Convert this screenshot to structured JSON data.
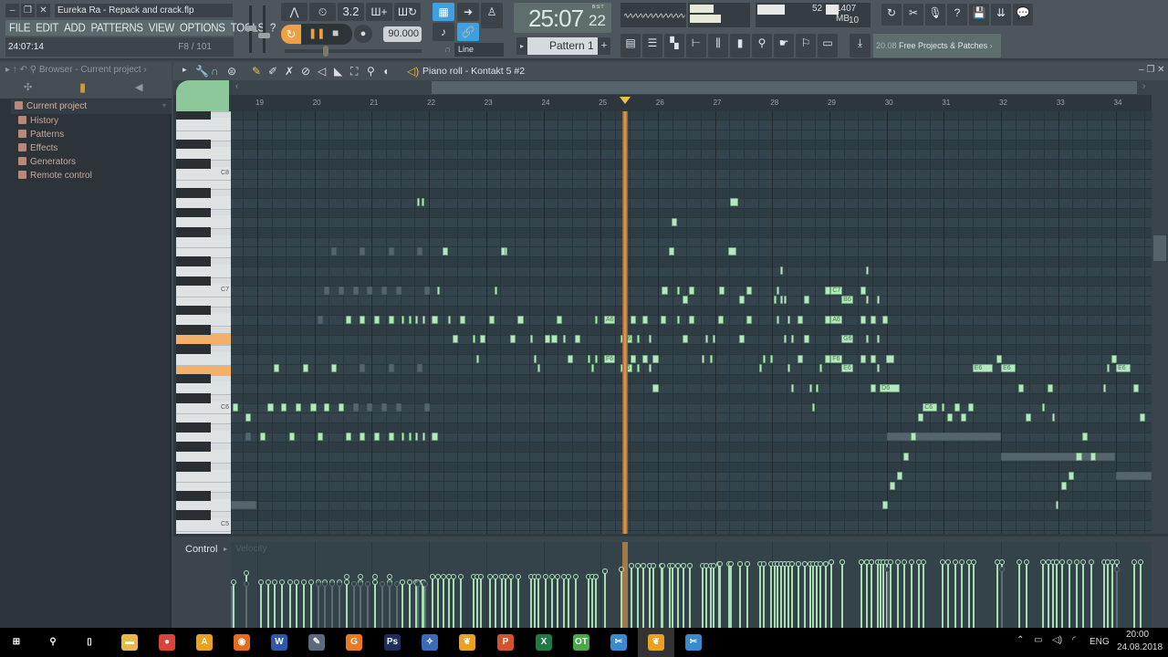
{
  "window": {
    "title": "Eureka Ra - Repack and crack.flp",
    "controls": [
      "minimize",
      "restore",
      "close"
    ]
  },
  "menu": [
    "FILE",
    "EDIT",
    "ADD",
    "PATTERNS",
    "VIEW",
    "OPTIONS",
    "TOOLS",
    "?"
  ],
  "hint": {
    "time": "24:07:14",
    "info": "F8 / 101"
  },
  "transport": {
    "tempo": "90.000",
    "snap_mode": "Line",
    "time_big": "25:07",
    "time_small": "22",
    "time_format": "B:S:T",
    "pattern": "Pattern 1",
    "pattern_add": "+",
    "step_label": "3.2"
  },
  "monitor": {
    "cpu": "52",
    "memory": "1407 MB",
    "polyphony": "10"
  },
  "news": {
    "date": "20.08",
    "text": "Free Projects & Patches"
  },
  "browser": {
    "header": "Browser - Current project",
    "root": "Current project",
    "items": [
      "History",
      "Patterns",
      "Effects",
      "Generators",
      "Remote control"
    ]
  },
  "piano_roll": {
    "title": "Piano roll - Kontakt 5 #2",
    "bars": [
      19,
      20,
      21,
      22,
      23,
      24,
      25,
      26,
      27,
      28,
      29,
      30,
      31,
      32,
      33,
      34
    ],
    "octave_labels": [
      "C8",
      "C7",
      "C6",
      "C5"
    ],
    "playhead_bar": 25.43,
    "highlighted_keys": [
      "G6",
      "E6"
    ],
    "accent": "#b5e8be",
    "playhead_color": "#e8a050"
  },
  "control": {
    "label": "Control",
    "param": "Velocity"
  },
  "notes": [
    [
      18.54,
      62,
      0.45,
      1,
      0.6
    ],
    [
      18.57,
      72,
      0.1,
      0,
      0.62
    ],
    [
      18.79,
      71,
      0.1,
      0,
      0.75
    ],
    [
      18.79,
      69,
      0.1,
      1,
      0.6
    ],
    [
      19.05,
      69,
      0.1,
      0,
      0.62
    ],
    [
      19.18,
      72,
      0.1,
      0,
      0.62
    ],
    [
      19.29,
      76,
      0.1,
      0,
      0.62
    ],
    [
      19.41,
      72,
      0.1,
      0,
      0.62
    ],
    [
      19.56,
      69,
      0.1,
      0,
      0.62
    ],
    [
      19.67,
      72,
      0.1,
      0,
      0.62
    ],
    [
      19.8,
      76,
      0.1,
      0,
      0.62
    ],
    [
      19.93,
      72,
      0.1,
      0,
      0.62
    ],
    [
      20.05,
      69,
      0.1,
      0,
      0.62
    ],
    [
      20.05,
      81,
      0.1,
      1,
      0.6
    ],
    [
      20.16,
      72,
      0.1,
      0,
      0.62
    ],
    [
      20.16,
      84,
      0.1,
      1,
      0.6
    ],
    [
      20.29,
      76,
      0.1,
      0,
      0.62
    ],
    [
      20.29,
      88,
      0.1,
      1,
      0.6
    ],
    [
      20.42,
      72,
      0.1,
      0,
      0.62
    ],
    [
      20.42,
      84,
      0.1,
      1,
      0.6
    ],
    [
      20.55,
      81,
      0.1,
      0,
      0.7
    ],
    [
      20.55,
      69,
      0.1,
      0,
      0.62
    ],
    [
      20.67,
      72,
      0.1,
      1,
      0.6
    ],
    [
      20.67,
      84,
      0.1,
      1,
      0.6
    ],
    [
      20.79,
      81,
      0.1,
      0,
      0.7
    ],
    [
      20.79,
      69,
      0.1,
      0,
      0.62
    ],
    [
      20.79,
      88,
      0.1,
      1,
      0.6
    ],
    [
      20.79,
      76,
      0.1,
      1,
      0.6
    ],
    [
      20.91,
      84,
      0.1,
      1,
      0.6
    ],
    [
      20.91,
      72,
      0.1,
      1,
      0.6
    ],
    [
      21.04,
      81,
      0.1,
      0,
      0.7
    ],
    [
      21.04,
      69,
      0.1,
      0,
      0.62
    ],
    [
      21.17,
      84,
      0.1,
      1,
      0.6
    ],
    [
      21.17,
      72,
      0.1,
      1,
      0.6
    ],
    [
      21.3,
      81,
      0.1,
      0,
      0.7
    ],
    [
      21.3,
      69,
      0.1,
      0,
      0.62
    ],
    [
      21.3,
      88,
      0.1,
      1,
      0.6
    ],
    [
      21.3,
      76,
      0.1,
      1,
      0.6
    ],
    [
      21.42,
      84,
      0.1,
      1,
      0.6
    ],
    [
      21.42,
      72,
      0.1,
      1,
      0.6
    ],
    [
      21.52,
      81,
      0.05,
      0,
      0.62
    ],
    [
      21.52,
      69,
      0.05,
      0,
      0.62
    ],
    [
      21.65,
      81,
      0.05,
      0,
      0.62
    ],
    [
      21.65,
      69,
      0.05,
      0,
      0.62
    ],
    [
      21.76,
      81,
      0.05,
      0,
      0.62
    ],
    [
      21.76,
      69,
      0.05,
      0,
      0.62
    ],
    [
      21.79,
      93,
      0.05,
      0,
      0.62
    ],
    [
      21.87,
      93,
      0.05,
      0,
      0.62
    ],
    [
      21.89,
      81,
      0.05,
      0,
      0.62
    ],
    [
      21.89,
      69,
      0.05,
      0,
      0.62
    ],
    [
      21.79,
      88,
      0.1,
      1,
      0.6
    ],
    [
      21.79,
      76,
      0.1,
      1,
      0.6
    ],
    [
      21.92,
      84,
      0.1,
      1,
      0.6
    ],
    [
      21.92,
      72,
      0.1,
      1,
      0.6
    ],
    [
      22.05,
      81,
      0.1,
      0,
      0.7
    ],
    [
      22.05,
      69,
      0.1,
      0,
      0.7
    ],
    [
      22.14,
      84,
      0.05,
      0,
      0.7
    ],
    [
      22.24,
      88,
      0.1,
      0,
      0.7
    ],
    [
      22.33,
      81,
      0.05,
      0,
      0.7
    ],
    [
      22.41,
      79,
      0.1,
      0,
      0.7
    ],
    [
      22.54,
      81,
      0.1,
      0,
      0.7
    ],
    [
      22.76,
      79,
      0.05,
      0,
      0.7
    ],
    [
      22.83,
      77,
      0.05,
      0,
      0.7
    ],
    [
      22.89,
      79,
      0.1,
      0,
      0.7
    ],
    [
      23.05,
      81,
      0.1,
      0,
      0.7
    ],
    [
      23.15,
      84,
      0.05,
      0,
      0.7
    ],
    [
      23.26,
      88,
      0.08,
      0,
      0.7
    ],
    [
      23.32,
      88,
      0.05,
      0,
      0.7
    ],
    [
      23.42,
      79,
      0.1,
      0,
      0.7
    ],
    [
      23.55,
      81,
      0.1,
      0,
      0.7
    ],
    [
      23.77,
      79,
      0.05,
      0,
      0.7
    ],
    [
      23.83,
      77,
      0.05,
      0,
      0.7
    ],
    [
      23.9,
      76,
      0.05,
      0,
      0.7
    ],
    [
      24.02,
      79,
      0.1,
      0,
      0.7
    ],
    [
      24.14,
      79,
      0.1,
      0,
      0.7
    ],
    [
      24.23,
      81,
      0.1,
      0,
      0.7
    ],
    [
      24.34,
      79,
      0.05,
      0,
      0.7
    ],
    [
      24.42,
      77,
      0.1,
      0,
      0.7
    ],
    [
      24.55,
      79,
      0.1,
      0,
      0.7
    ],
    [
      24.77,
      77,
      0.05,
      0,
      0.7
    ],
    [
      24.84,
      76,
      0.05,
      0,
      0.7
    ],
    [
      24.9,
      81,
      0.05,
      0,
      0.7
    ],
    [
      24.9,
      77,
      0.05,
      0,
      0.7
    ],
    [
      25.06,
      81,
      0.2,
      0,
      0.78
    ],
    [
      25.06,
      77,
      0.2,
      0,
      0.78
    ],
    [
      25.35,
      79,
      0.2,
      0,
      0.8
    ],
    [
      25.35,
      76,
      0.2,
      0,
      0.8
    ],
    [
      25.52,
      81,
      0.1,
      0,
      0.85
    ],
    [
      25.52,
      77,
      0.1,
      0,
      0.85
    ],
    [
      25.63,
      79,
      0.05,
      0,
      0.85
    ],
    [
      25.63,
      76,
      0.05,
      0,
      0.85
    ],
    [
      25.73,
      81,
      0.1,
      0,
      0.85
    ],
    [
      25.73,
      77,
      0.1,
      0,
      0.85
    ],
    [
      25.84,
      79,
      0.05,
      0,
      0.85
    ],
    [
      25.84,
      76,
      0.05,
      0,
      0.85
    ],
    [
      25.91,
      77,
      0.1,
      0,
      0.85
    ],
    [
      25.91,
      74,
      0.1,
      0,
      0.85
    ],
    [
      26.05,
      81,
      0.1,
      0,
      0.85
    ],
    [
      26.07,
      84,
      0.1,
      0,
      0.85
    ],
    [
      26.19,
      88,
      0.1,
      0,
      0.85
    ],
    [
      26.24,
      91,
      0.1,
      0,
      0.85
    ],
    [
      26.34,
      84,
      0.05,
      0,
      0.85
    ],
    [
      26.34,
      81,
      0.05,
      0,
      0.85
    ],
    [
      26.43,
      83,
      0.1,
      0,
      0.85
    ],
    [
      26.43,
      79,
      0.1,
      0,
      0.85
    ],
    [
      26.54,
      84,
      0.1,
      0,
      0.85
    ],
    [
      26.54,
      81,
      0.1,
      0,
      0.85
    ],
    [
      26.77,
      77,
      0.05,
      0,
      0.85
    ],
    [
      26.83,
      79,
      0.05,
      0,
      0.85
    ],
    [
      26.91,
      77,
      0.05,
      0,
      0.85
    ],
    [
      26.96,
      79,
      0.05,
      0,
      0.85
    ],
    [
      27.05,
      81,
      0.1,
      0,
      0.88
    ],
    [
      27.07,
      84,
      0.1,
      0,
      0.88
    ],
    [
      27.23,
      88,
      0.15,
      0,
      0.88
    ],
    [
      27.26,
      93,
      0.15,
      0,
      0.88
    ],
    [
      27.42,
      83,
      0.1,
      0,
      0.88
    ],
    [
      27.42,
      79,
      0.1,
      0,
      0.88
    ],
    [
      27.55,
      84,
      0.1,
      0,
      0.88
    ],
    [
      27.55,
      81,
      0.1,
      0,
      0.88
    ],
    [
      27.77,
      76,
      0.05,
      0,
      0.88
    ],
    [
      27.84,
      77,
      0.05,
      0,
      0.88
    ],
    [
      27.96,
      77,
      0.05,
      0,
      0.88
    ],
    [
      28.03,
      83,
      0.05,
      0,
      0.88
    ],
    [
      28.08,
      84,
      0.05,
      0,
      0.88
    ],
    [
      28.08,
      81,
      0.05,
      0,
      0.88
    ],
    [
      28.14,
      86,
      0.05,
      0,
      0.88
    ],
    [
      28.14,
      83,
      0.05,
      0,
      0.88
    ],
    [
      28.2,
      83,
      0.05,
      0,
      0.88
    ],
    [
      28.2,
      79,
      0.05,
      0,
      0.88
    ],
    [
      28.27,
      81,
      0.05,
      0,
      0.88
    ],
    [
      28.27,
      76,
      0.05,
      0,
      0.88
    ],
    [
      28.33,
      79,
      0.05,
      0,
      0.88
    ],
    [
      28.33,
      74,
      0.05,
      0,
      0.88
    ],
    [
      28.44,
      81,
      0.1,
      0,
      0.88
    ],
    [
      28.44,
      77,
      0.1,
      0,
      0.88
    ],
    [
      28.55,
      83,
      0.1,
      0,
      0.88
    ],
    [
      28.55,
      79,
      0.1,
      0,
      0.88
    ],
    [
      28.65,
      74,
      0.05,
      0,
      0.88
    ],
    [
      28.7,
      72,
      0.05,
      0,
      0.88
    ],
    [
      28.76,
      74,
      0.05,
      0,
      0.88
    ],
    [
      28.82,
      76,
      0.05,
      0,
      0.88
    ],
    [
      28.92,
      84,
      0.1,
      0,
      0.88
    ],
    [
      28.92,
      81,
      0.1,
      0,
      0.88
    ],
    [
      28.92,
      77,
      0.1,
      0,
      0.88
    ],
    [
      29.02,
      84,
      0.2,
      0,
      0.9
    ],
    [
      29.02,
      81,
      0.2,
      0,
      0.9
    ],
    [
      29.02,
      77,
      0.2,
      0,
      0.9
    ],
    [
      29.21,
      83,
      0.2,
      0,
      0.9
    ],
    [
      29.21,
      79,
      0.2,
      0,
      0.9
    ],
    [
      29.21,
      76,
      0.2,
      0,
      0.9
    ],
    [
      29.54,
      84,
      0.1,
      0,
      0.9
    ],
    [
      29.54,
      81,
      0.1,
      0,
      0.9
    ],
    [
      29.54,
      77,
      0.1,
      0,
      0.9
    ],
    [
      29.64,
      86,
      0.05,
      0,
      0.9
    ],
    [
      29.64,
      83,
      0.05,
      0,
      0.9
    ],
    [
      29.64,
      79,
      0.05,
      0,
      0.9
    ],
    [
      29.72,
      81,
      0.1,
      0,
      0.9
    ],
    [
      29.72,
      77,
      0.1,
      0,
      0.9
    ],
    [
      29.72,
      74,
      0.1,
      0,
      0.9
    ],
    [
      29.83,
      83,
      0.05,
      0,
      0.9
    ],
    [
      29.83,
      79,
      0.05,
      0,
      0.9
    ],
    [
      29.83,
      76,
      0.05,
      0,
      0.9
    ],
    [
      29.88,
      74,
      0.35,
      0,
      0.9
    ],
    [
      29.92,
      81,
      0.1,
      0,
      0.9
    ],
    [
      29.92,
      62,
      0.1,
      0,
      0.9
    ],
    [
      29.99,
      77,
      0.15,
      0,
      0.9
    ],
    [
      30.0,
      69,
      2.0,
      1,
      0.8
    ],
    [
      30.05,
      64,
      0.1,
      0,
      0.9
    ],
    [
      30.18,
      65,
      0.1,
      0,
      0.9
    ],
    [
      30.29,
      67,
      0.1,
      0,
      0.9
    ],
    [
      30.42,
      69,
      0.1,
      0,
      0.9
    ],
    [
      30.55,
      71,
      0.1,
      0,
      0.9
    ],
    [
      30.63,
      72,
      0.25,
      0,
      0.9
    ],
    [
      30.96,
      72,
      0.05,
      0,
      0.9
    ],
    [
      31.06,
      71,
      0.1,
      0,
      0.9
    ],
    [
      31.18,
      72,
      0.1,
      0,
      0.9
    ],
    [
      31.3,
      71,
      0.1,
      0,
      0.9
    ],
    [
      31.42,
      72,
      0.1,
      0,
      0.9
    ],
    [
      31.5,
      76,
      0.36,
      0,
      0.9
    ],
    [
      31.92,
      77,
      0.1,
      0,
      0.9
    ],
    [
      32.0,
      76,
      0.25,
      0,
      0.9
    ],
    [
      32.0,
      67,
      2.0,
      1,
      0.8
    ],
    [
      32.3,
      74,
      0.1,
      0,
      0.9
    ],
    [
      32.43,
      71,
      0.1,
      0,
      0.9
    ],
    [
      32.72,
      72,
      0.05,
      0,
      0.9
    ],
    [
      32.81,
      74,
      0.1,
      0,
      0.9
    ],
    [
      32.89,
      71,
      0.05,
      0,
      0.9
    ],
    [
      32.96,
      62,
      0.05,
      0,
      0.9
    ],
    [
      33.05,
      64,
      0.1,
      0,
      0.9
    ],
    [
      33.18,
      65,
      0.1,
      0,
      0.9
    ],
    [
      33.31,
      67,
      0.1,
      0,
      0.9
    ],
    [
      33.42,
      69,
      0.1,
      0,
      0.9
    ],
    [
      33.56,
      67,
      0.1,
      0,
      0.9
    ],
    [
      33.78,
      74,
      0.05,
      0,
      0.9
    ],
    [
      33.85,
      76,
      0.05,
      0,
      0.9
    ],
    [
      33.93,
      77,
      0.1,
      0,
      0.9
    ],
    [
      34.01,
      76,
      0.25,
      0,
      0.9
    ],
    [
      34.01,
      65,
      0.62,
      1,
      0.8
    ],
    [
      34.31,
      74,
      0.1,
      0,
      0.9
    ],
    [
      34.42,
      71,
      0.1,
      0,
      0.9
    ]
  ],
  "taskbar": {
    "apps": [
      {
        "name": "start",
        "glyph": "⊞",
        "color": "#000000"
      },
      {
        "name": "search",
        "glyph": "⚲",
        "color": "#000000"
      },
      {
        "name": "task-view",
        "glyph": "▯",
        "color": "#000000"
      },
      {
        "name": "file-explorer",
        "glyph": "▬",
        "color": "#e8b84a"
      },
      {
        "name": "chrome",
        "glyph": "●",
        "color": "#d9433a"
      },
      {
        "name": "aimp",
        "glyph": "A",
        "color": "#e8a21f"
      },
      {
        "name": "firefox",
        "glyph": "◉",
        "color": "#e86a1f"
      },
      {
        "name": "word",
        "glyph": "W",
        "color": "#2b5ba8"
      },
      {
        "name": "paint",
        "glyph": "✎",
        "color": "#5a6a7a"
      },
      {
        "name": "g-app",
        "glyph": "G",
        "color": "#ea7a20"
      },
      {
        "name": "photoshop",
        "glyph": "Ps",
        "color": "#1d2e5c"
      },
      {
        "name": "app-2",
        "glyph": "✧",
        "color": "#3a6ab8"
      },
      {
        "name": "fl-studio",
        "glyph": "❦",
        "color": "#e8a21f"
      },
      {
        "name": "powerpoint",
        "glyph": "P",
        "color": "#d35230"
      },
      {
        "name": "excel",
        "glyph": "X",
        "color": "#1f7a45"
      },
      {
        "name": "ot",
        "glyph": "OT",
        "color": "#4aa84a"
      },
      {
        "name": "remote-1",
        "glyph": "✂",
        "color": "#3a8ad0"
      },
      {
        "name": "fl-studio-active",
        "glyph": "❦",
        "color": "#e8a21f"
      },
      {
        "name": "remote-2",
        "glyph": "✂",
        "color": "#3a8ad0"
      }
    ],
    "language": "ENG",
    "time": "20:00",
    "date": "24.08.2018"
  }
}
